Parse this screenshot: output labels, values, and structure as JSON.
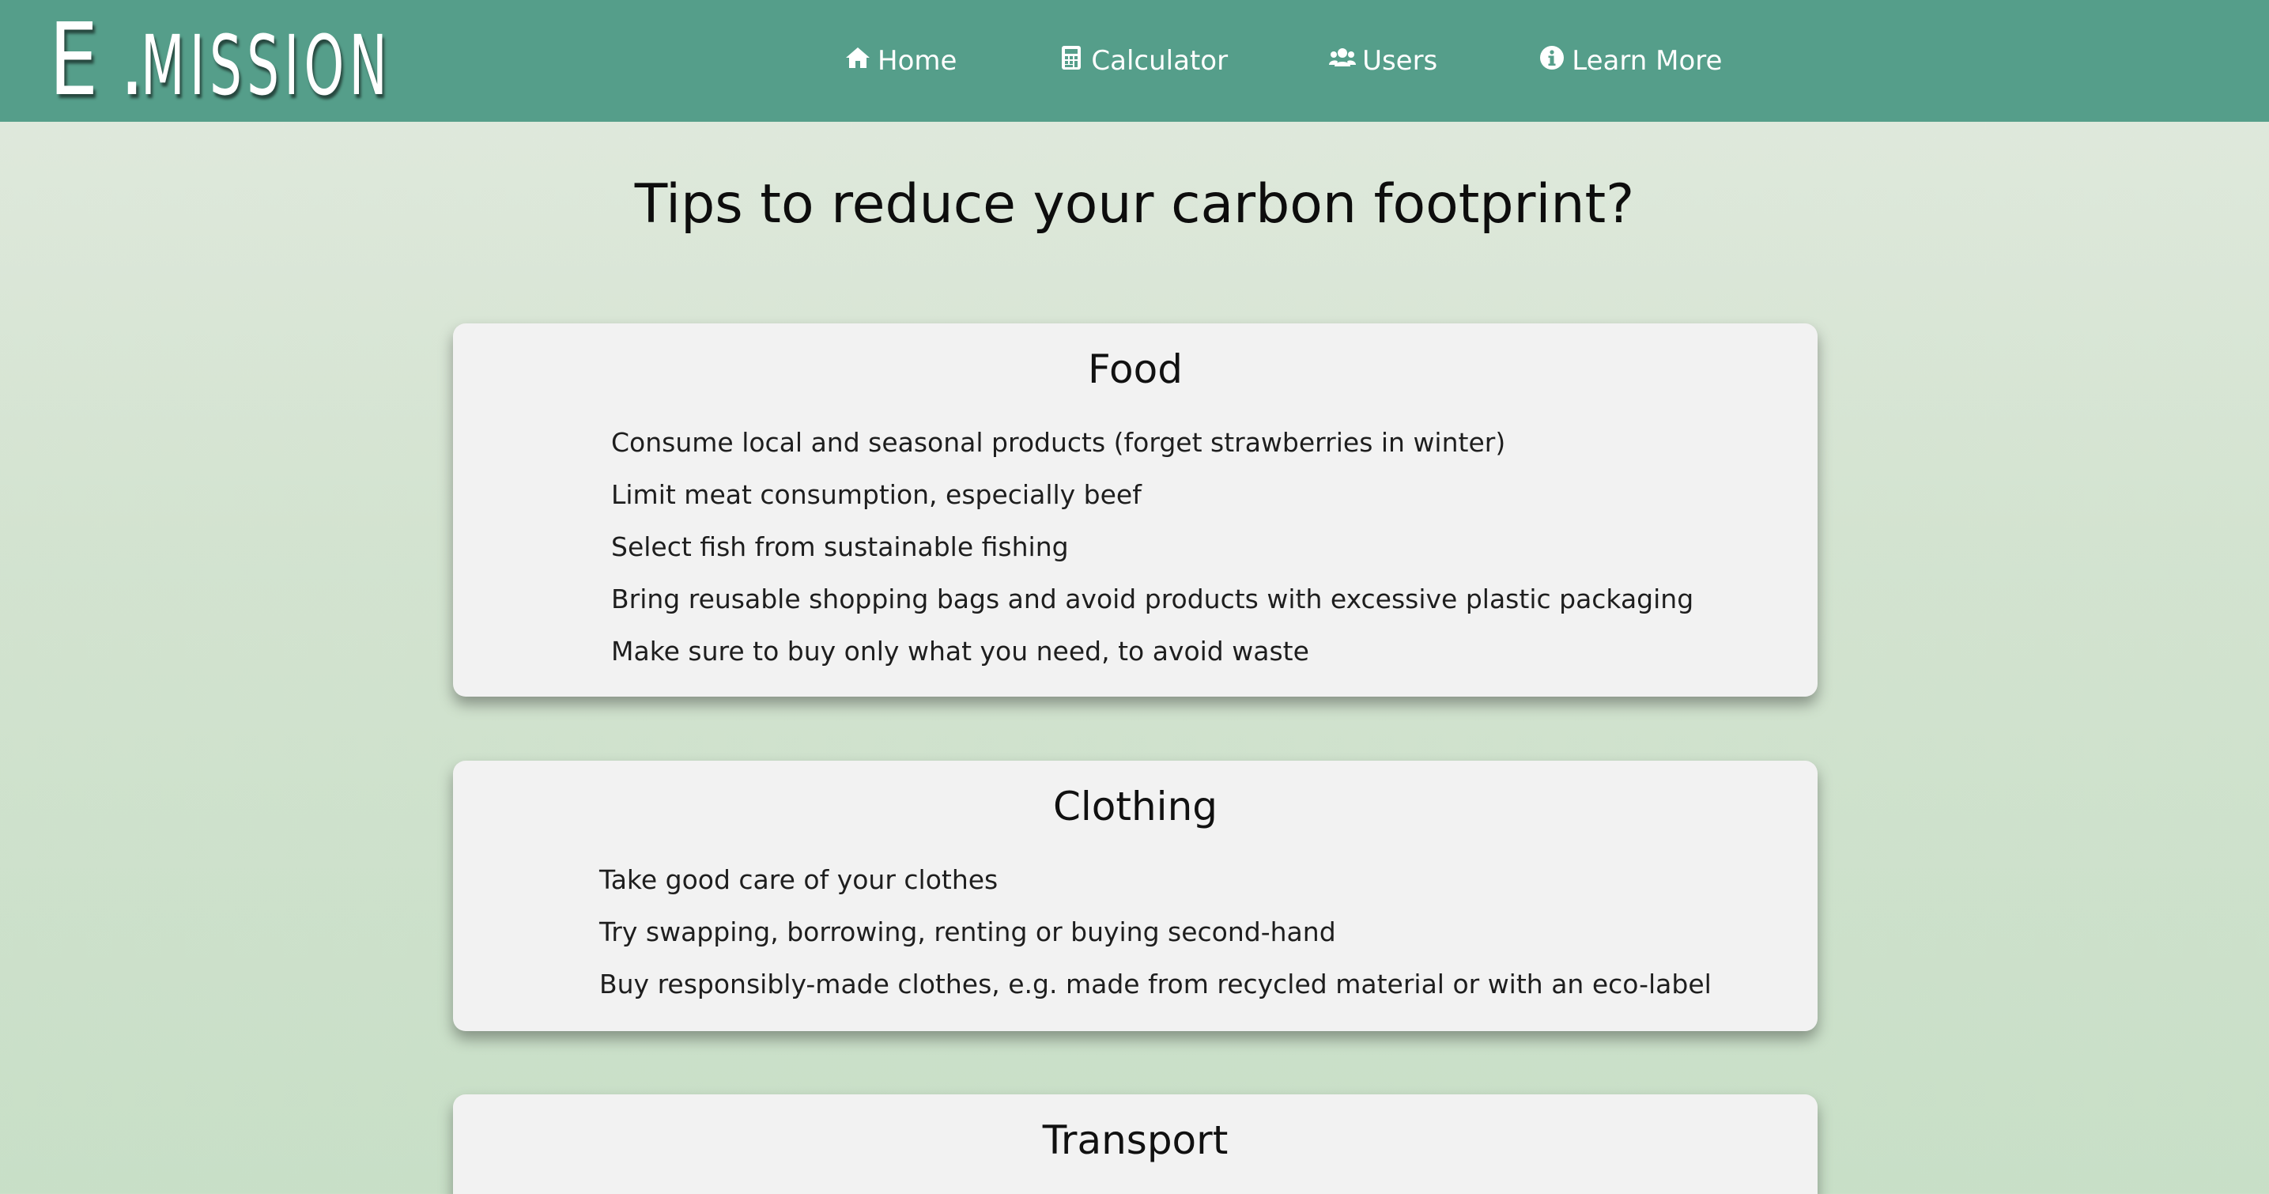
{
  "brand": {
    "logo_big": "E",
    "logo_dot": ".",
    "logo_rest": "mission"
  },
  "nav": {
    "items": [
      {
        "label": "Home",
        "icon": "home-icon"
      },
      {
        "label": "Calculator",
        "icon": "calculator-icon"
      },
      {
        "label": "Users",
        "icon": "users-icon"
      },
      {
        "label": "Learn More",
        "icon": "info-icon"
      }
    ]
  },
  "page": {
    "title": "Tips to reduce your carbon footprint?"
  },
  "sections": [
    {
      "title": "Food",
      "tips": [
        "Consume local and seasonal products (forget strawberries in winter)",
        "Limit meat consumption, especially beef",
        "Select fish from sustainable fishing",
        "Bring reusable shopping bags and avoid products with excessive plastic packaging",
        "Make sure to buy only what you need, to avoid waste"
      ]
    },
    {
      "title": "Clothing",
      "tips": [
        "Take good care of your clothes",
        "Try swapping, borrowing, renting or buying second-hand",
        "Buy responsibly-made clothes, e.g. made from recycled material or with an eco-label"
      ]
    },
    {
      "title": "Transport",
      "tips": []
    }
  ],
  "colors": {
    "navbar": "#559e8a",
    "background_top": "#e2eadf",
    "background_bottom": "#c8dfc7",
    "card": "#f2f2f2"
  }
}
